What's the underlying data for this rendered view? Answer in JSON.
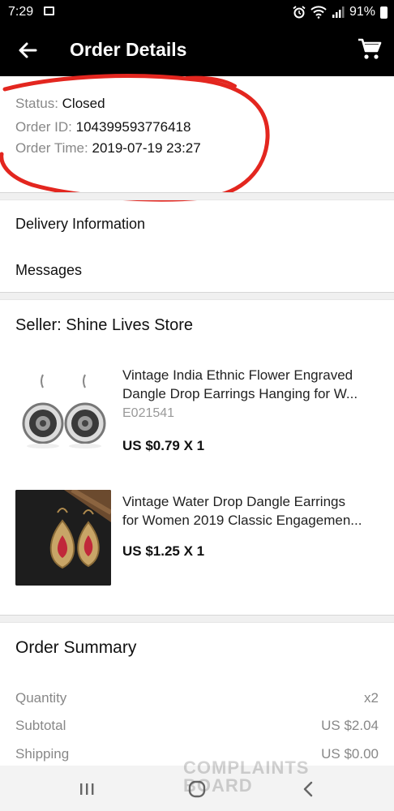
{
  "status_bar": {
    "time": "7:29",
    "battery": "91%"
  },
  "appbar": {
    "title": "Order Details"
  },
  "order": {
    "status_label": "Status:",
    "status_value": "Closed",
    "id_label": "Order ID:",
    "id_value": "104399593776418",
    "time_label": "Order Time:",
    "time_value": "2019-07-19 23:27"
  },
  "links": {
    "delivery": "Delivery Information",
    "messages": "Messages"
  },
  "seller": {
    "label": "Seller: Shine Lives Store"
  },
  "products": [
    {
      "title_line1": "Vintage India Ethnic Flower Engraved",
      "title_line2": "Dangle Drop Earrings Hanging for W...",
      "sku": "E021541",
      "price": "US $0.79 X 1"
    },
    {
      "title_line1": "Vintage Water Drop Dangle Earrings",
      "title_line2": "for Women 2019 Classic Engagemen...",
      "price": "US $1.25 X 1"
    }
  ],
  "summary": {
    "title": "Order Summary",
    "rows": [
      {
        "label": "Quantity",
        "value": "x2"
      },
      {
        "label": "Subtotal",
        "value": "US $2.04"
      },
      {
        "label": "Shipping",
        "value": "US $0.00"
      }
    ]
  },
  "watermark": {
    "line1": "COMPLAINTS",
    "line2": "BOARD"
  },
  "icons": {
    "back": "arrow-left-icon",
    "cart": "cart-icon",
    "nav_recent": "recent-apps-icon",
    "nav_home": "home-icon",
    "nav_back": "back-chevron-icon"
  },
  "colors": {
    "annotation": "#e3261f",
    "appbar": "#000000"
  }
}
